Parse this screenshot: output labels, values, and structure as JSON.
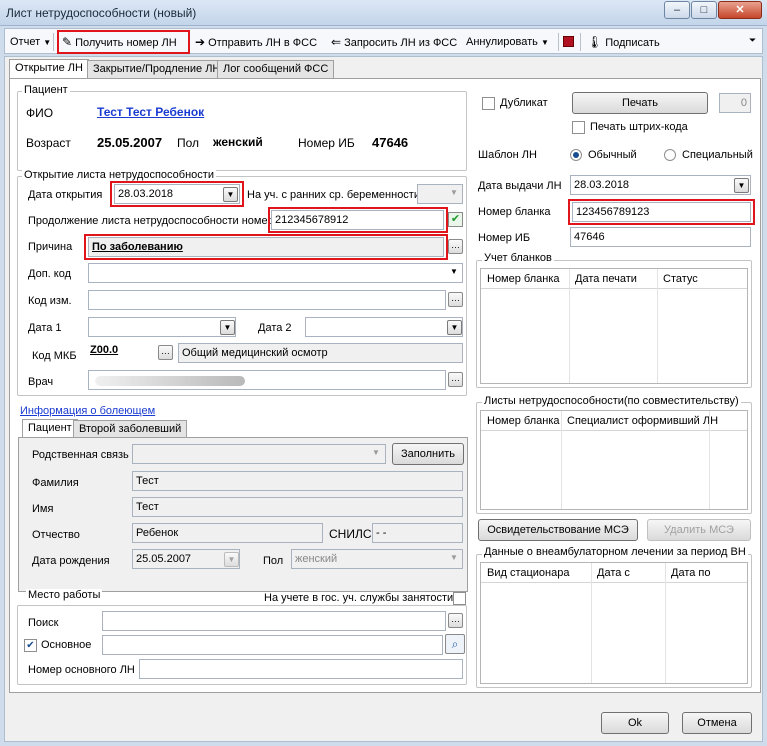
{
  "window": {
    "title": "Лист нетрудоспособности (новый)",
    "min": "–",
    "max": "□",
    "close": "✕"
  },
  "toolbar": {
    "report": "Отчет",
    "get_number": "Получить номер ЛН",
    "send": "Отправить ЛН в ФСС",
    "request": "Запросить ЛН из ФСС",
    "annul": "Аннулировать",
    "sign": "Подписать"
  },
  "tabs": [
    "Открытие ЛН",
    "Закрытие/Продление ЛН",
    "Лог сообщений ФСС"
  ],
  "patient": {
    "group": "Пациент",
    "fio_label": "ФИО",
    "fio": "Тест Тест Ребенок",
    "age_label": "Возраст",
    "birthdate": "25.05.2007",
    "sex_label": "Пол",
    "sex": "женский",
    "ib_label": "Номер ИБ",
    "ib": "47646"
  },
  "opening": {
    "group": "Открытие листа нетрудоспособности",
    "date_label": "Дата открытия",
    "date": "28.03.2018",
    "pregnancy_label": "На уч. с ранних ср. беременности",
    "continuation_label": "Продолжение листа нетрудоспособности номер",
    "continuation": "212345678912",
    "reason_label": "Причина",
    "reason": "По заболеванию",
    "extra_code_label": "Доп. код",
    "change_code_label": "Код изм.",
    "date1_label": "Дата 1",
    "date2_label": "Дата 2",
    "mkb_label": "Код МКБ",
    "mkb_code": "Z00.0",
    "mkb_text": "Общий медицинский осмотр",
    "doctor_label": "Врач"
  },
  "sick_info": {
    "link": "Информация о болеющем",
    "tabs": [
      "Пациент",
      "Второй заболевший"
    ],
    "relation_label": "Родственная связь",
    "fill_button": "Заполнить",
    "last_label": "Фамилия",
    "last": "Тест",
    "first_label": "Имя",
    "first": "Тест",
    "middle_label": "Отчество",
    "middle": "Ребенок",
    "snils_label": "СНИЛС",
    "snils": "-  -",
    "birth_label": "Дата рождения",
    "birth": "25.05.2007",
    "sex_label": "Пол",
    "sex": "женский"
  },
  "work": {
    "group": "Место работы",
    "employment_label": "На учете в гос. уч. службы занятости",
    "search_label": "Поиск",
    "main_label": "Основное",
    "main_ln_label": "Номер основного ЛН"
  },
  "right": {
    "duplicate_label": "Дубликат",
    "print_button": "Печать",
    "print_count": "0",
    "barcode_label": "Печать штрих-кода",
    "template_label": "Шаблон ЛН",
    "template_normal": "Обычный",
    "template_special": "Специальный",
    "issue_date_label": "Дата выдачи ЛН",
    "issue_date": "28.03.2018",
    "blank_label": "Номер бланка",
    "blank": "123456789123",
    "ib_label": "Номер ИБ",
    "ib": "47646"
  },
  "blanks": {
    "group": "Учет бланков",
    "columns": [
      "Номер бланка",
      "Дата печати",
      "Статус"
    ]
  },
  "parttime": {
    "group": "Листы нетрудоспособности(по совместительству)",
    "columns": [
      "Номер бланка",
      "Специалист оформивший ЛН"
    ]
  },
  "mse": {
    "exam_button": "Освидетельствование МСЭ",
    "delete_button": "Удалить МСЭ"
  },
  "outpatient": {
    "group": "Данные о внеамбулаторном лечении за период ВН",
    "columns": [
      "Вид стационара",
      "Дата с",
      "Дата по"
    ]
  },
  "footer": {
    "ok": "Ok",
    "cancel": "Отмена"
  }
}
